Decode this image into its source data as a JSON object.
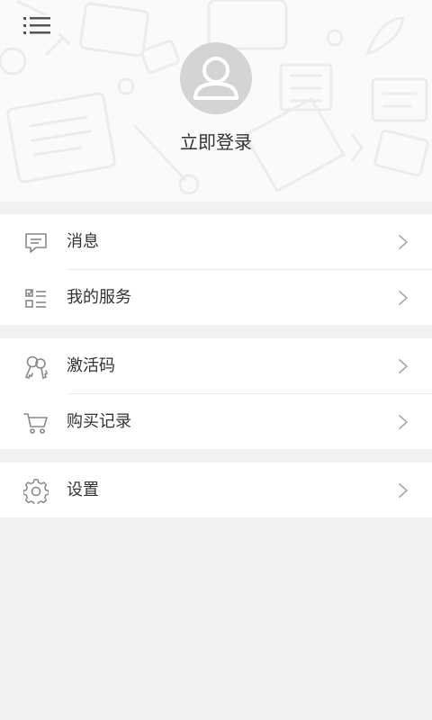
{
  "header": {
    "login_text": "立即登录"
  },
  "menu": {
    "group1": [
      {
        "label": "消息",
        "icon": "message-icon"
      },
      {
        "label": "我的服务",
        "icon": "checklist-icon"
      }
    ],
    "group2": [
      {
        "label": "激活码",
        "icon": "keys-icon"
      },
      {
        "label": "购买记录",
        "icon": "cart-icon"
      }
    ],
    "group3": [
      {
        "label": "设置",
        "icon": "gear-icon"
      }
    ]
  },
  "colors": {
    "page_background": "#f1f1f1",
    "header_background": "#fafafa",
    "avatar_background": "#d4d4d4",
    "icon_stroke": "#888888",
    "chevron": "#aaaaaa"
  }
}
